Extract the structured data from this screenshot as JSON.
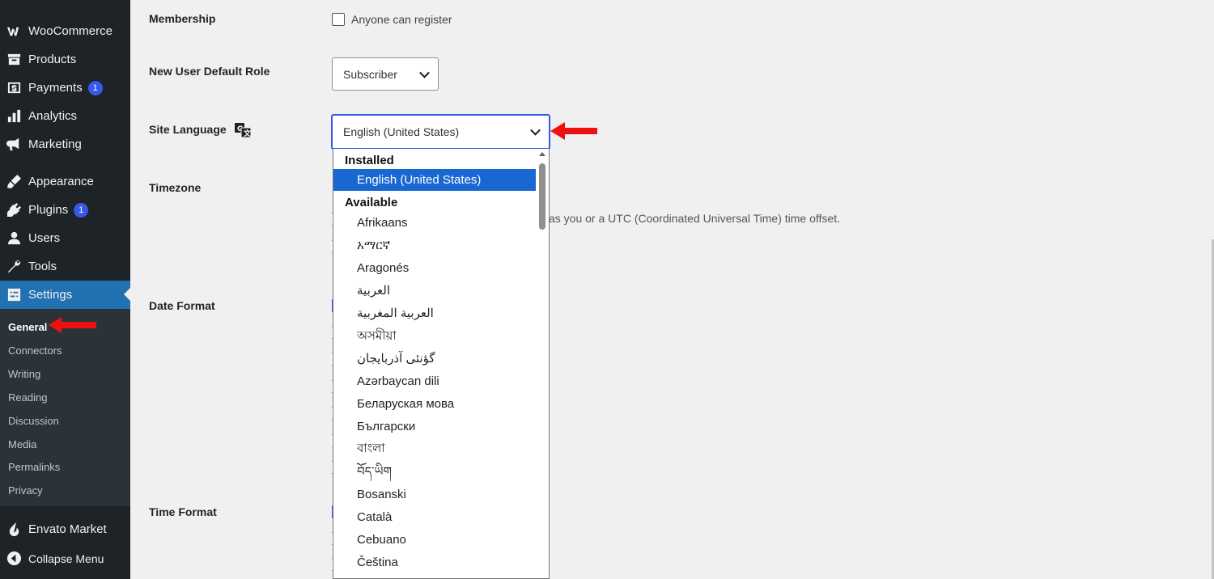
{
  "sidebar": {
    "items": [
      {
        "label": "WooCommerce",
        "icon": "woocommerce-icon"
      },
      {
        "label": "Products",
        "icon": "products-icon"
      },
      {
        "label": "Payments",
        "icon": "payments-icon",
        "badge": "1"
      },
      {
        "label": "Analytics",
        "icon": "analytics-icon"
      },
      {
        "label": "Marketing",
        "icon": "marketing-icon"
      },
      {
        "label": "Appearance",
        "icon": "appearance-icon"
      },
      {
        "label": "Plugins",
        "icon": "plugins-icon",
        "badge": "1"
      },
      {
        "label": "Users",
        "icon": "users-icon"
      },
      {
        "label": "Tools",
        "icon": "tools-icon"
      },
      {
        "label": "Settings",
        "icon": "settings-icon",
        "active": true
      },
      {
        "label": "Envato Market",
        "icon": "envato-icon"
      },
      {
        "label": "Collapse Menu",
        "icon": "collapse-icon"
      }
    ],
    "submenu": [
      "General",
      "Connectors",
      "Writing",
      "Reading",
      "Discussion",
      "Media",
      "Permalinks",
      "Privacy"
    ],
    "current_submenu": "General"
  },
  "form": {
    "membership": {
      "label": "Membership",
      "checkbox_label": "Anyone can register",
      "checked": false
    },
    "default_role": {
      "label": "New User Default Role",
      "value": "Subscriber"
    },
    "site_language": {
      "label": "Site Language",
      "value": "English (United States)"
    },
    "timezone": {
      "label": "Timezone",
      "description_partial": "as you or a UTC (Coordinated Universal Time) time offset."
    },
    "date_format": {
      "label": "Date Format"
    },
    "time_format": {
      "label": "Time Format"
    }
  },
  "dropdown": {
    "installed_label": "Installed",
    "installed": [
      "English (United States)"
    ],
    "available_label": "Available",
    "available": [
      "Afrikaans",
      "አማርኛ",
      "Aragonés",
      "العربية",
      "العربية المغربية",
      "অসমীয়া",
      "گؤنئی آذربایجان",
      "Azərbaycan dili",
      "Беларуская мова",
      "Български",
      "বাংলা",
      "བོད་ཡིག",
      "Bosanski",
      "Català",
      "Cebuano",
      "Čeština"
    ]
  },
  "colors": {
    "sidebar_bg": "#1d2327",
    "active_bg": "#2271b1",
    "badge": "#3858e9",
    "selected_option": "#1967d2",
    "annotation_arrow": "#ee1111"
  }
}
